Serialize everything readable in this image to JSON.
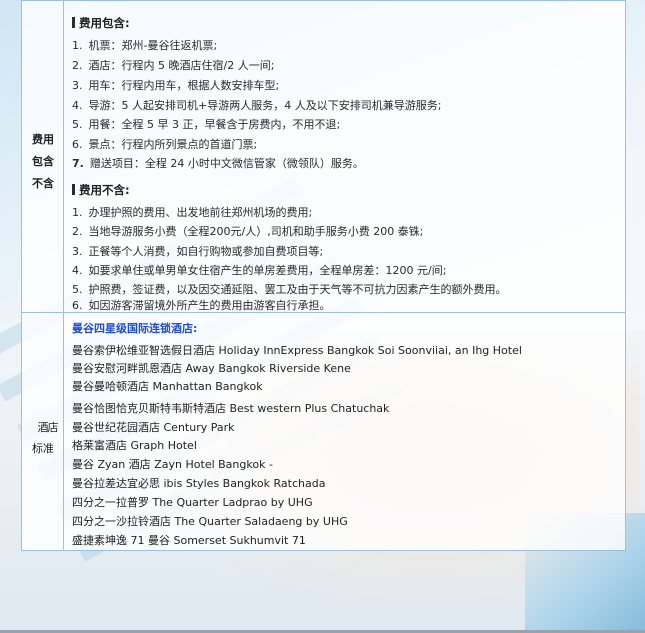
{
  "fees": {
    "label": [
      "费用",
      "包含",
      "不含"
    ],
    "included_heading": "费用包含:",
    "included_items": [
      {
        "n": "1.",
        "text": "机票：郑州-曼谷往返机票;"
      },
      {
        "n": "2.",
        "text": "酒店：行程内 5 晚酒店住宿/2 人一间;"
      },
      {
        "n": "3.",
        "text": "用车：行程内用车，根据人数安排车型;"
      },
      {
        "n": "4.",
        "text": "导游：5 人起安排司机+导游两人服务，4 人及以下安排司机兼导游服务;"
      },
      {
        "n": "5.",
        "text": "用餐：全程 5 早 3 正，早餐含于房费内，不用不退;"
      },
      {
        "n": "6.",
        "text": "景点：行程内所列景点的首道门票;"
      },
      {
        "n": "7.",
        "text": "赠送项目：全程 24 小时中文微信管家（微领队）服务。"
      }
    ],
    "excluded_heading": "费用不含:",
    "excluded_items": [
      {
        "n": "1.",
        "text": "办理护照的费用、出发地前往郑州机场的费用;"
      },
      {
        "n": "2.",
        "text": "当地导游服务小费（全程200元/人）,司机和助手服务小费 200 泰铢;"
      },
      {
        "n": "3.",
        "text": "正餐等个人消费，如自行购物或参加自费项目等;"
      },
      {
        "n": "4.",
        "text": "如要求单住或单男单女住宿产生的单房差费用，全程单房差：1200 元/间;"
      },
      {
        "n": "5.",
        "text": "护照费，签证费，以及因交通延阻、罢工及由于天气等不可抗力因素产生的额外费用。"
      },
      {
        "n": "6.",
        "text": "如因游客滞留境外所产生的费用由游客自行承担。"
      }
    ]
  },
  "hotels": {
    "label": [
      "酒",
      "店",
      "标准"
    ],
    "heading": "曼谷四星级国际连锁酒店:",
    "items": [
      "曼谷索伊松维亚智选假日酒店 Holiday InnExpress Bangkok Soi Soonviiai, an Ihg Hotel",
      "曼谷安慰河畔凯恩酒店 Away Bangkok Riverside Kene",
      "曼谷曼哈顿酒店 Manhattan Bangkok",
      "曼谷恰图恰克贝斯特韦斯特酒店 Best western Plus Chatuchak",
      "曼谷世纪花园酒店 Century Park",
      "格莱富酒店 Graph Hotel",
      "曼谷 Zyan 酒店 Zayn Hotel Bangkok   -",
      "曼谷拉差达宜必思 ibis Styles Bangkok Ratchada",
      "四分之一拉普罗 The Quarter Ladprao by UHG",
      "四分之一沙拉铃酒店 The Quarter Saladaeng by UHG",
      "盛捷素坤逸 71 曼谷 Somerset Sukhumvit 71"
    ]
  }
}
